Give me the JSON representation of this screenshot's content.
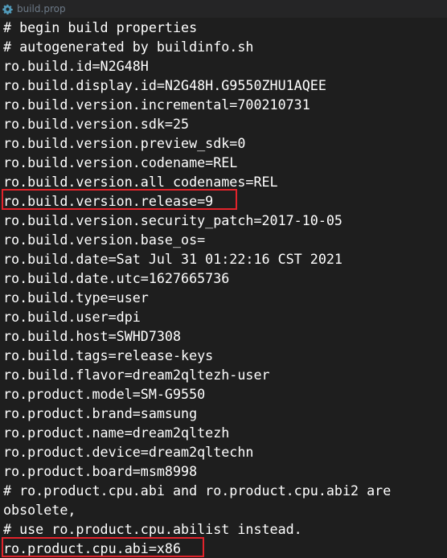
{
  "tab": {
    "icon": "gear-icon",
    "label": "build.prop"
  },
  "lines": [
    "# begin build properties",
    "# autogenerated by buildinfo.sh",
    "ro.build.id=N2G48H",
    "ro.build.display.id=N2G48H.G9550ZHU1AQEE",
    "ro.build.version.incremental=700210731",
    "ro.build.version.sdk=25",
    "ro.build.version.preview_sdk=0",
    "ro.build.version.codename=REL",
    "ro.build.version.all_codenames=REL",
    "ro.build.version.release=9",
    "ro.build.version.security_patch=2017-10-05",
    "ro.build.version.base_os=",
    "ro.build.date=Sat Jul 31 01:22:16 CST 2021",
    "ro.build.date.utc=1627665736",
    "ro.build.type=user",
    "ro.build.user=dpi",
    "ro.build.host=SWHD7308",
    "ro.build.tags=release-keys",
    "ro.build.flavor=dream2qltezh-user",
    "ro.product.model=SM-G9550",
    "ro.product.brand=samsung",
    "ro.product.name=dream2qltezh",
    "ro.product.device=dream2qltechn",
    "ro.product.board=msm8998",
    "# ro.product.cpu.abi and ro.product.cpu.abi2 are",
    "obsolete,",
    "# use ro.product.cpu.abilist instead.",
    "ro.product.cpu.abi=x86"
  ],
  "highlight_color": "#e3232b"
}
